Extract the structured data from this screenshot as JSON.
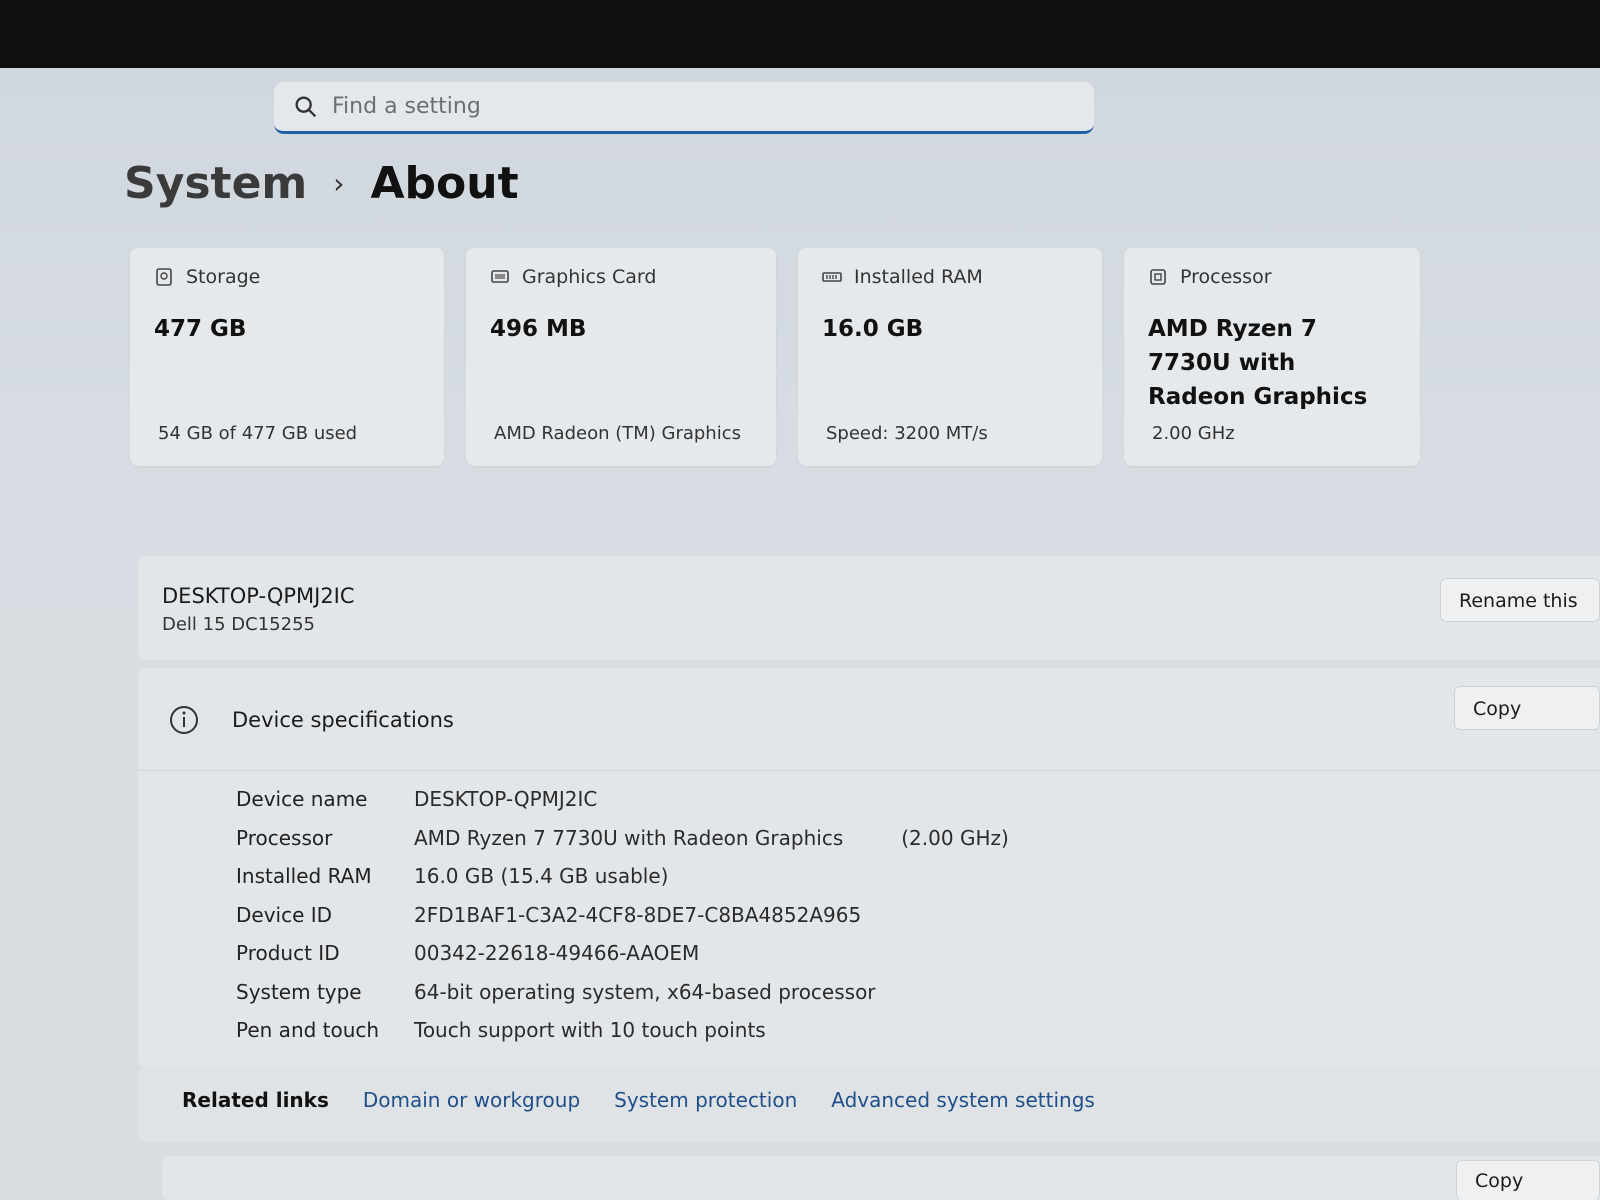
{
  "search": {
    "placeholder": "Find a setting"
  },
  "breadcrumb": {
    "parent": "System",
    "separator": "›",
    "current": "About"
  },
  "cards": [
    {
      "title": "Storage",
      "value": "477 GB",
      "sub": "54 GB of 477 GB used",
      "icon": "storage-icon"
    },
    {
      "title": "Graphics Card",
      "value": "496 MB",
      "sub": "AMD Radeon (TM) Graphics",
      "icon": "graphics-card-icon"
    },
    {
      "title": "Installed RAM",
      "value": "16.0 GB",
      "sub": "Speed: 3200 MT/s",
      "icon": "ram-icon"
    },
    {
      "title": "Processor",
      "value": "AMD Ryzen 7 7730U with Radeon Graphics",
      "sub": "2.00 GHz",
      "icon": "processor-icon"
    }
  ],
  "device": {
    "name": "DESKTOP-QPMJ2IC",
    "model": "Dell 15 DC15255",
    "rename_label": "Rename this"
  },
  "specs": {
    "title": "Device specifications",
    "copy_label": "Copy",
    "rows": [
      {
        "label": "Device name",
        "value": "DESKTOP-QPMJ2IC"
      },
      {
        "label": "Processor",
        "value": "AMD Ryzen 7 7730U with Radeon Graphics",
        "extra": "(2.00 GHz)"
      },
      {
        "label": "Installed RAM",
        "value": "16.0 GB (15.4 GB usable)"
      },
      {
        "label": "Device ID",
        "value": "2FD1BAF1-C3A2-4CF8-8DE7-C8BA4852A965"
      },
      {
        "label": "Product ID",
        "value": "00342-22618-49466-AAOEM"
      },
      {
        "label": "System type",
        "value": "64-bit operating system, x64-based processor"
      },
      {
        "label": "Pen and touch",
        "value": "Touch support with 10 touch points"
      }
    ]
  },
  "related_links": {
    "label": "Related links",
    "links": [
      "Domain or workgroup",
      "System protection",
      "Advanced system settings"
    ]
  },
  "bottom": {
    "copy_label": "Copy"
  },
  "colors": {
    "accent": "#1f5da6",
    "link": "#1f4f8a"
  }
}
